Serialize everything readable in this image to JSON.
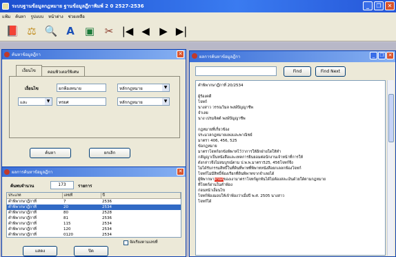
{
  "app": {
    "title": "ระบบฐานข้อมูลกฎหมาย   ฐานข้อมูลฎีกาพิมพ์ 2 0 2527-2536",
    "menu": [
      "แฟ้ม",
      "ค้นหา",
      "รูปแบบ",
      "หน้าต่าง",
      "ช่วยเหลือ"
    ]
  },
  "toolbar": {
    "nav": [
      "|◀",
      "◀",
      "▶",
      "▶|"
    ]
  },
  "search_window": {
    "title": "ค้นหาข้อมูลฎีกา",
    "tabs": [
      "เงื่อนไข",
      "คอมพิวเตอร์พิเศษ"
    ],
    "row1": {
      "label": "เงื่อนไข",
      "value": "ยกฟ้องทนาย",
      "mode": "หลักกฎหมาย"
    },
    "row2": {
      "op": "และ",
      "value": "ทรยศ",
      "mode": "หลักกฎหมาย"
    },
    "search_button": "ค้นหา",
    "cancel_button": "ยกเลิก"
  },
  "result_window": {
    "title": "ผลการค้นหาข้อมูลฎีกา",
    "count_label": "ค้นพบจำนวน",
    "count": "173",
    "count_unit": "รายการ",
    "columns": [
      "ประเภท",
      "เลขที่",
      "ปี"
    ],
    "rows": [
      [
        "คำพิพากษาฎีกาที่",
        "7",
        "2536"
      ],
      [
        "คำพิพากษาฎีกาที่",
        "20",
        "2534"
      ],
      [
        "คำพิพากษาฎีกาที่",
        "80",
        "2528"
      ],
      [
        "คำพิพากษาฎีกาที่",
        "81",
        "2536"
      ],
      [
        "คำพิพากษาฎีกาที่",
        "115",
        "2534"
      ],
      [
        "คำพิพากษาฎีกาที่",
        "120",
        "2534"
      ],
      [
        "คำพิพากษาฎีกาที่",
        "0120",
        "2534"
      ]
    ],
    "selected_row": 1,
    "checkbox_label": "จัดเรียงตามเลขที่",
    "show_button": "แสดง",
    "close_button": "ปิด"
  },
  "detail_window": {
    "title": "ผลการค้นหาข้อมูลฎีกา",
    "find_placeholder": "",
    "find_button": "Find",
    "find_next_button": "Find Next",
    "lines": [
      "คำพิพากษาฎีกาที่ 20/2534",
      "",
      "                        ผู้ร้องคดี",
      "โจทก์",
      "              นางสาว วรรณวิมล พงษ์ปัญญาชีพ",
      "จำเลย",
      "              นาง เปรมจิตต์ พงษ์ปัญญาชีพ",
      "",
      "กฎหมายที่เกี่ยวข้อง",
      "              ประมวลกฎหมายแพ่งและพาณิชย์",
      "              มาตรา 406, 456, 525",
      "              ข้อกฎหมาย",
      "              มาตราโจทก์ยกข้อพิพาทไว้ว่าการให้อีกฝ่ายใดให้ทำ",
      "กสัญญาเป็นหนังสือและเทคการยินยอมต่อนักงานเจ้าหน้าที่การให้",
      "ดังกล่าวจึงไม่สมบูรณ์ตาม ป.พ.พ.มาตรา525, 456โจทก์จึง",
      "ไม่ได้รับกรรมสิทธิ์ในที่ดินที่พาทที่พิพาทหนังสือยกเลลกฟ้องโจทก์",
      "โจทก์ไม่มีสิทธิ์ฟ้องเรียกที่ดินพิพาทจากจำเลยได้",
      "ผู้พิพากษา[ทรยศ]ของเงามาตราโจทก์ผูกพันได้ไม่ต้องสละเงินด้วยใด้ตามกฎหมาย",
      "ที่โจทก์ผ่านในคำฟ้อง",
      "              ก่อนหน้าเงื่อนไข",
      "              โจทก์ฟ้องมอบให้เจ้าฟ้องว่าเมื่อปี พ.ศ. 2505 นางสาว",
      "โจทก์ได้"
    ],
    "highlight_word": "ทรยศ"
  }
}
